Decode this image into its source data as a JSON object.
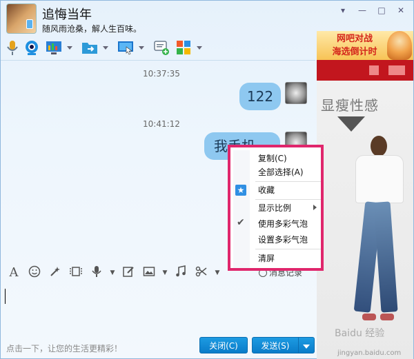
{
  "window": {
    "nickname": "追悔当年",
    "signature": "随风雨沧桑，解人生百味。",
    "controls": [
      "▾",
      "—",
      "□",
      "✕"
    ]
  },
  "toolbar": {
    "icons": [
      "microphone-icon",
      "video-call-icon",
      "remote-desktop-icon",
      "send-file-icon",
      "screen-share-icon",
      "app-add-icon",
      "apps-grid-icon"
    ]
  },
  "chat": {
    "messages": [
      {
        "time": "10:37:35",
        "text": "122"
      },
      {
        "time": "10:41:12",
        "text": "我手机"
      }
    ]
  },
  "input_toolbar": {
    "font_label": "A",
    "history_label": "消息记录"
  },
  "input": {
    "placeholder": ""
  },
  "footer": {
    "tip": "点击一下，让您的生活更精彩！",
    "close_label": "关闭(C)",
    "send_label": "发送(S)"
  },
  "context_menu": {
    "items": [
      {
        "label": "复制(C)"
      },
      {
        "label": "全部选择(A)"
      },
      {
        "label": "收藏"
      },
      {
        "label": "显示比例"
      },
      {
        "label": "使用多彩气泡"
      },
      {
        "label": "设置多彩气泡"
      },
      {
        "label": "清屏"
      }
    ]
  },
  "ad": {
    "banner_line1": "网吧对战",
    "banner_line2": "海选倒计时",
    "title": "显瘦性感",
    "watermark": "Baidu 经验",
    "watermark_sub": "jingyan.baidu.com"
  },
  "colors": {
    "accent": "#0a7cc9",
    "menu_border": "#e0266c",
    "bubble": "#8ec8f0"
  }
}
